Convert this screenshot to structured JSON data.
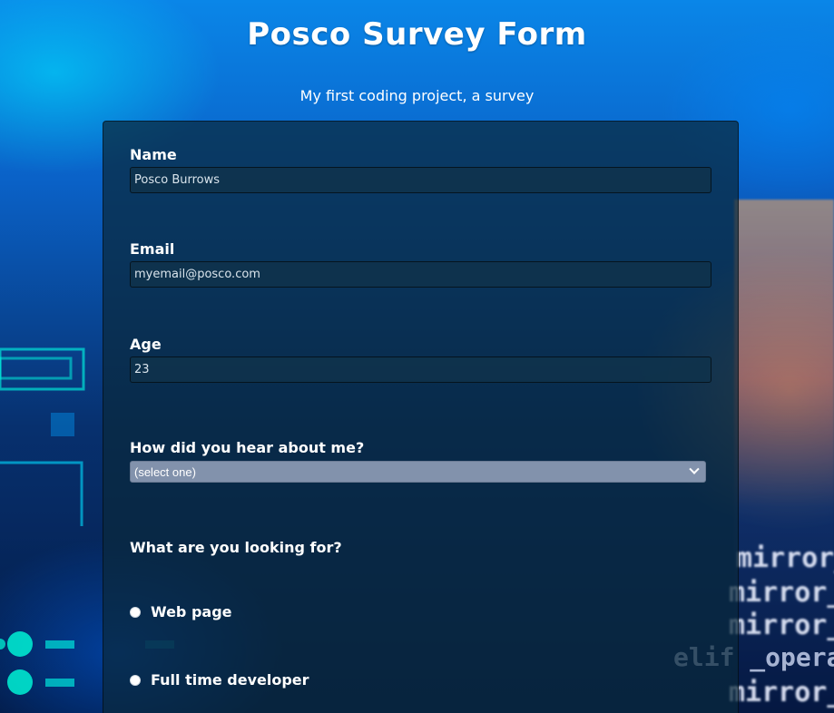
{
  "header": {
    "title": "Posco Survey Form",
    "description": "My first coding project, a survey"
  },
  "form": {
    "name": {
      "label": "Name",
      "value": "Posco Burrows"
    },
    "email": {
      "label": "Email",
      "value": "myemail@posco.com"
    },
    "age": {
      "label": "Age",
      "value": "23"
    },
    "referral": {
      "label": "How did you hear about me?",
      "selected": "(select one)"
    },
    "looking_for": {
      "label": "What are you looking for?",
      "options": [
        {
          "label": "Web page"
        },
        {
          "label": "Full time developer"
        }
      ]
    }
  },
  "background": {
    "code_lines": [
      "mirror_",
      "mirror_",
      "mirror_",
      "elif _opera",
      "mirror_"
    ]
  },
  "colors": {
    "card_bg": "#0a283c",
    "select_bg": "#8292ac",
    "text": "#ffffff"
  }
}
